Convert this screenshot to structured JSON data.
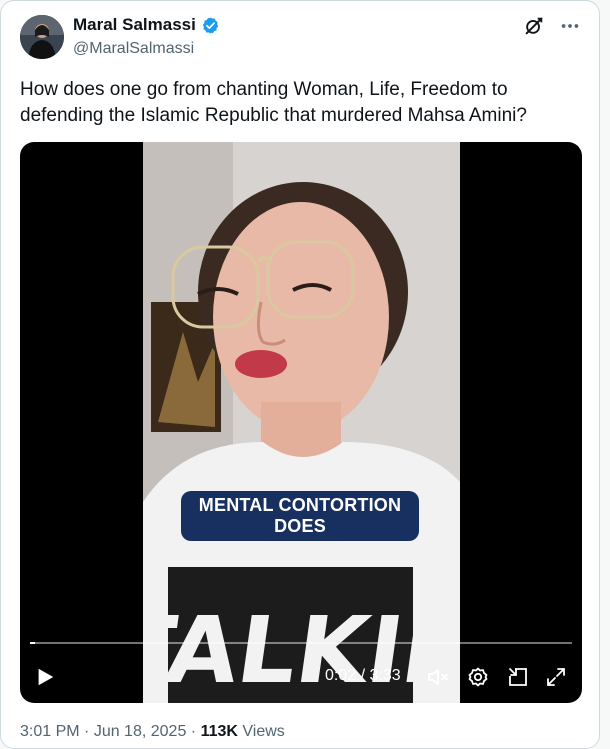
{
  "author": {
    "name": "Maral Salmassi",
    "handle": "@MaralSalmassi"
  },
  "tweet": {
    "text": "How does one go from chanting Woman, Life, Freedom to defending the Islamic Republic that murdered Mahsa Amini?"
  },
  "video": {
    "caption_line1": "MENTAL CONTORTION",
    "caption_line2": "DOES",
    "shirt_text": "TALKING",
    "current_time": "0:02",
    "separator": " / ",
    "duration": "3:33",
    "progress_fraction": 0.01
  },
  "meta": {
    "time": "3:01 PM",
    "dot1": " · ",
    "date": "Jun 18, 2025",
    "dot2": " · ",
    "views_count": "113K",
    "views_label": " Views"
  },
  "icons": {
    "verified": "verified-badge-icon",
    "grok": "grok-icon",
    "more": "more-icon",
    "play": "play-icon",
    "mute": "mute-icon",
    "settings": "settings-gear-icon",
    "pip": "picture-in-picture-icon",
    "fullscreen": "fullscreen-icon"
  },
  "colors": {
    "accent": "#1d9bf0",
    "caption_bg": "#17305f"
  }
}
